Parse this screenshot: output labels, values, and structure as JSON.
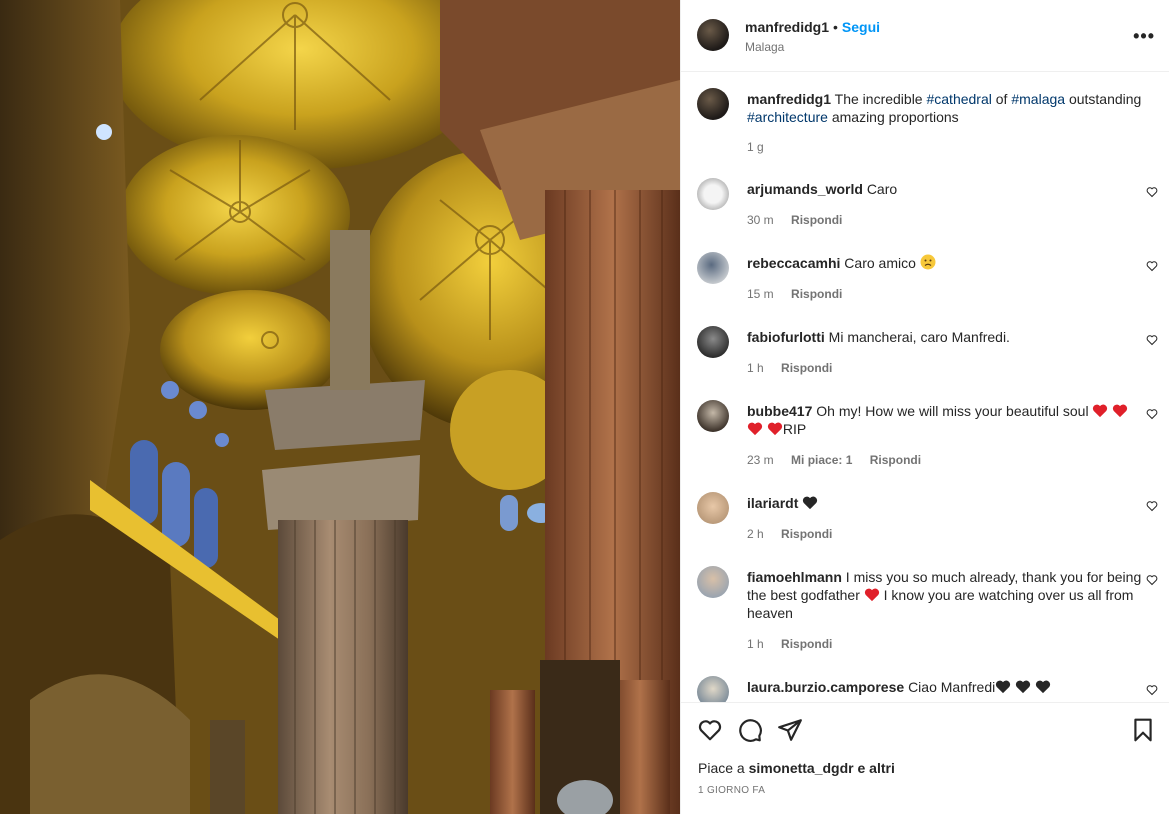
{
  "post": {
    "username": "manfredidg1",
    "separator": "•",
    "follow_label": "Segui",
    "location": "Malaga",
    "more_label": "•••"
  },
  "caption": {
    "username": "manfredidg1",
    "text_1": "The incredible",
    "tag_1": "#cathedral",
    "text_2": "of",
    "tag_2": "#malaga",
    "text_3": "outstanding",
    "tag_3": "#architecture",
    "text_4": "amazing proportions",
    "time": "1 g"
  },
  "comments": [
    {
      "username": "arjumands_world",
      "text": "Caro",
      "time": "30 m",
      "reply": "Rispondi"
    },
    {
      "username": "rebeccacamhi",
      "text": "Caro amico",
      "emoji": "sad-face",
      "time": "15 m",
      "reply": "Rispondi"
    },
    {
      "username": "fabiofurlotti",
      "text": "Mi mancherai, caro Manfredi.",
      "time": "1 h",
      "reply": "Rispondi"
    },
    {
      "username": "bubbe417",
      "text": "Oh my! How we will miss your beautiful soul",
      "text_after": "RIP",
      "time": "23 m",
      "likes": "Mi piace: 1",
      "reply": "Rispondi"
    },
    {
      "username": "ilariardt",
      "text": "",
      "time": "2 h",
      "reply": "Rispondi"
    },
    {
      "username": "fiamoehlmann",
      "text": "I miss you so much already, thank you for being the best godfather",
      "text_after": "I know you are watching over us all from heaven",
      "time": "1 h",
      "reply": "Rispondi"
    },
    {
      "username": "laura.burzio.camporese",
      "text": "Ciao Manfredi"
    }
  ],
  "footer": {
    "likes_prefix": "Piace a",
    "likes_user": "simonetta_dgdr",
    "likes_suffix": "e altri",
    "time_ago": "1 GIORNO FA"
  },
  "colors": {
    "accent": "#0095f6",
    "hashtag": "#00376b",
    "heart": "#ed1c24",
    "black_heart": "#262626"
  }
}
